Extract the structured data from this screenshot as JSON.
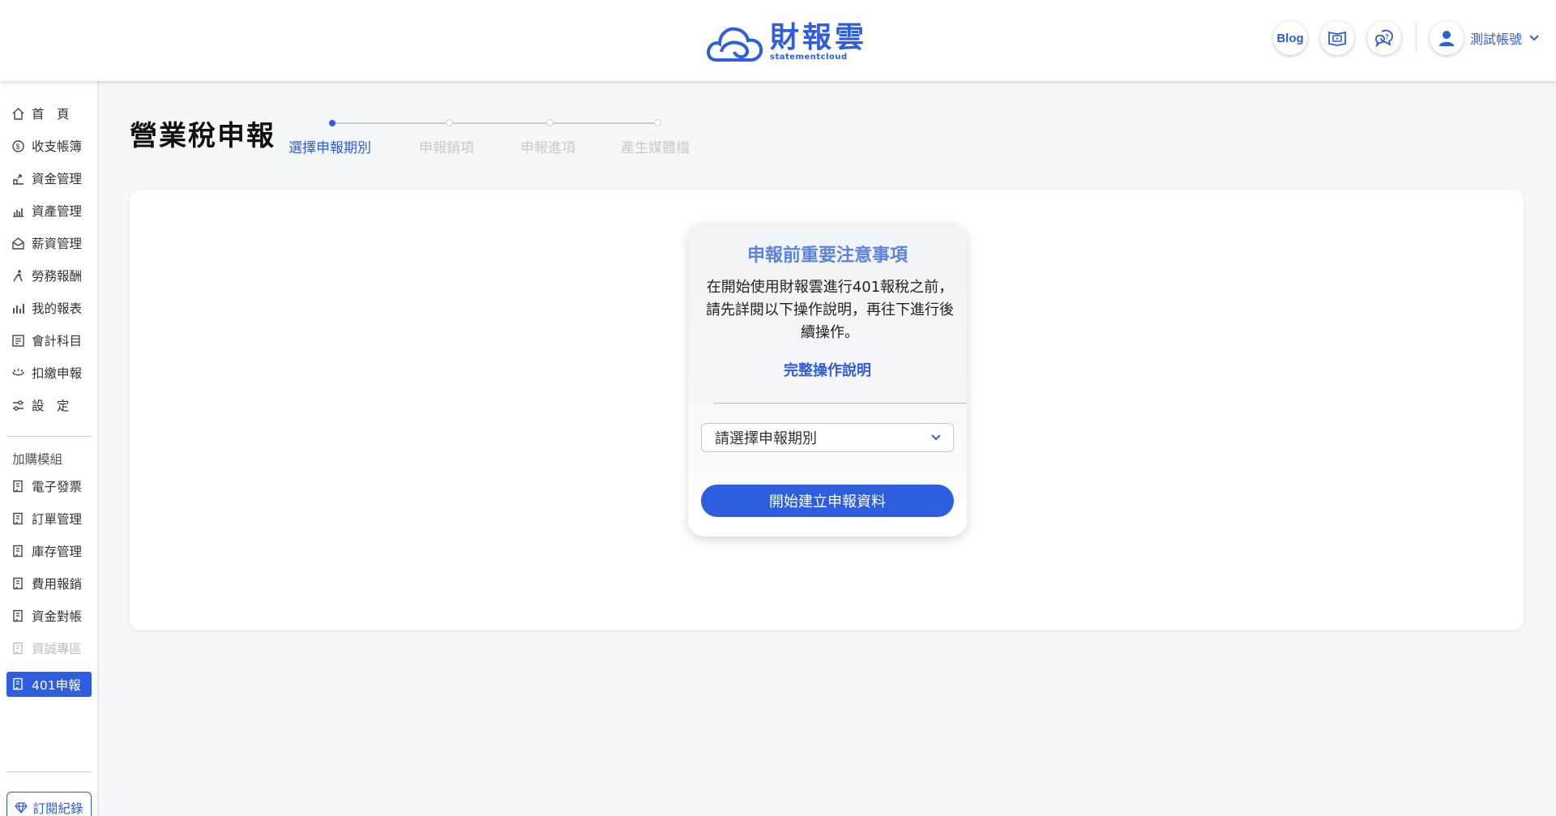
{
  "brand": {
    "name_cn": "財報雲",
    "name_en": "statementcloud",
    "color": "#2d5ee0"
  },
  "header": {
    "blog_label": "Blog",
    "user_name": "測試帳號"
  },
  "sidebar": {
    "items": [
      {
        "label": "首　頁",
        "icon": "home-icon"
      },
      {
        "label": "收支帳簿",
        "icon": "coin-icon"
      },
      {
        "label": "資金管理",
        "icon": "funds-icon"
      },
      {
        "label": "資產管理",
        "icon": "asset-chart-icon"
      },
      {
        "label": "薪資管理",
        "icon": "payroll-icon"
      },
      {
        "label": "勞務報酬",
        "icon": "labor-icon"
      },
      {
        "label": "我的報表",
        "icon": "report-chart-icon"
      },
      {
        "label": "會計科目",
        "icon": "ledger-icon"
      },
      {
        "label": "扣繳申報",
        "icon": "withholding-icon"
      },
      {
        "label": "設　定",
        "icon": "settings-sliders-icon"
      }
    ],
    "addon_label": "加購模組",
    "addons": [
      {
        "label": "電子發票",
        "icon": "module-icon"
      },
      {
        "label": "訂單管理",
        "icon": "module-icon"
      },
      {
        "label": "庫存管理",
        "icon": "module-icon"
      },
      {
        "label": "費用報銷",
        "icon": "module-icon"
      },
      {
        "label": "資金對帳",
        "icon": "module-icon"
      },
      {
        "label": "資誠專區",
        "icon": "module-icon"
      },
      {
        "label": "401申報",
        "icon": "module-icon"
      }
    ],
    "subscription_label": "訂閱紀錄"
  },
  "page": {
    "title": "營業稅申報",
    "steps": [
      "選擇申報期別",
      "申報銷項",
      "申報進項",
      "產生媒體檔"
    ],
    "active_step": 0
  },
  "notice": {
    "title": "申報前重要注意事項",
    "body": "在開始使用財報雲進行401報稅之前，請先詳閱以下操作說明，再往下進行後續操作。",
    "link_label": "完整操作說明",
    "select_placeholder": "請選擇申報期別",
    "start_button": "開始建立申報資料"
  }
}
